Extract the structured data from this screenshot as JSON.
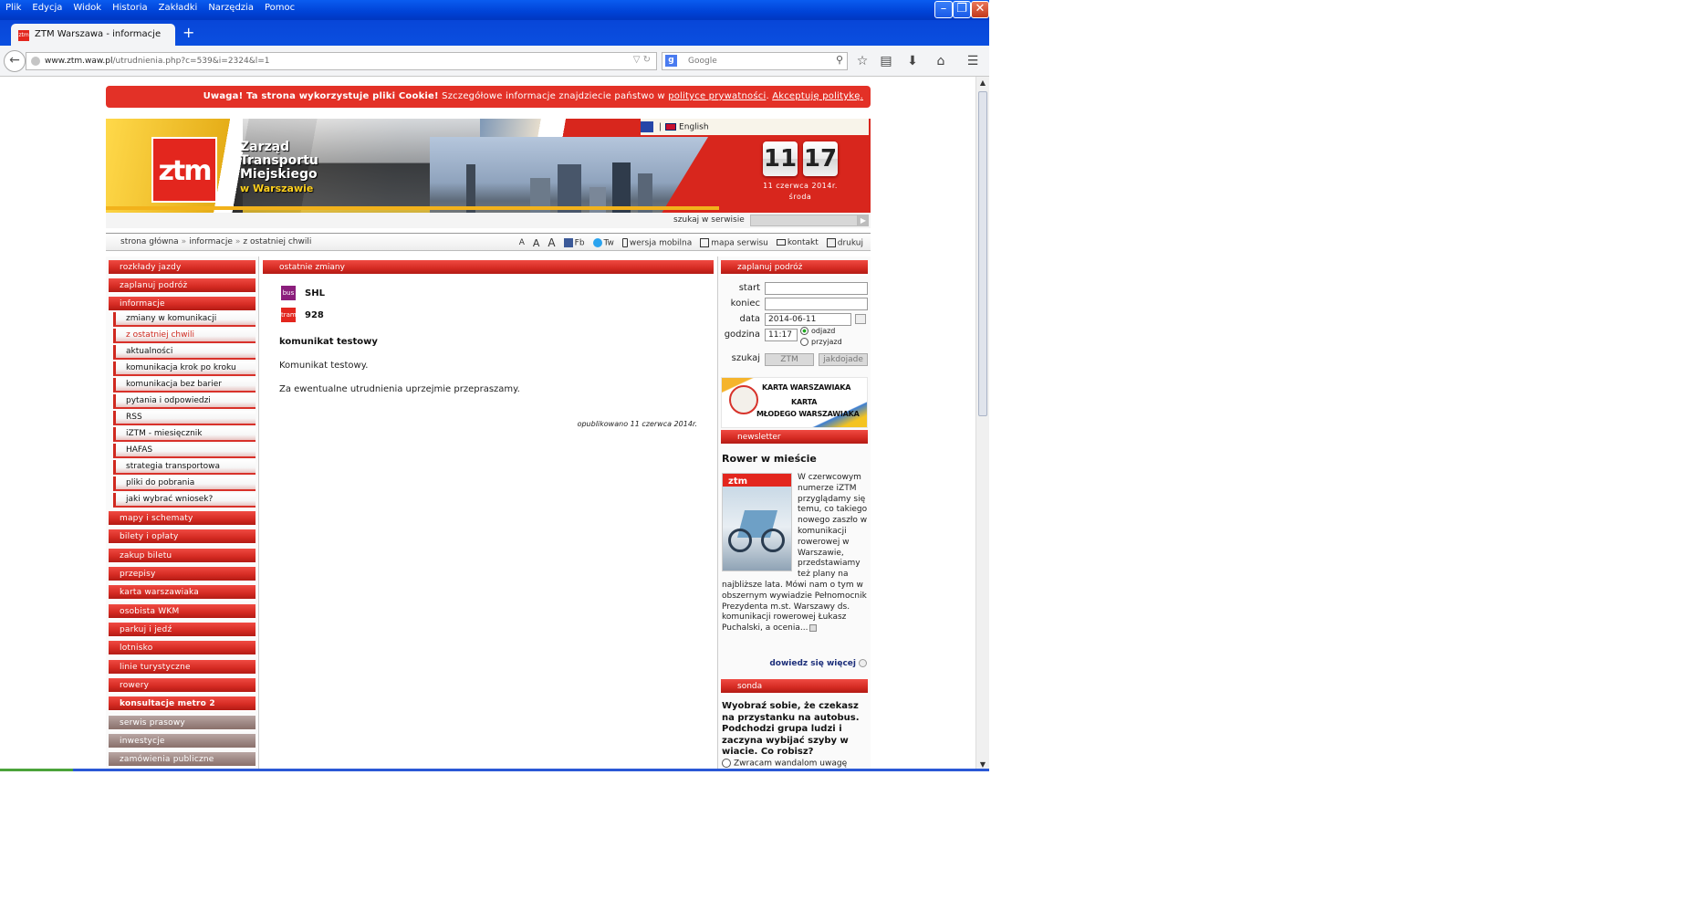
{
  "browser": {
    "menu": [
      "Plik",
      "Edycja",
      "Widok",
      "Historia",
      "Zakładki",
      "Narzędzia",
      "Pomoc"
    ],
    "tab_title": "ZTM Warszawa - informacje",
    "favicon_text": "ztm",
    "url_domain": "www.ztm.waw.pl",
    "url_path": "/utrudnienia.php?c=539&i=2324&l=1",
    "search_placeholder": "Google",
    "icons": [
      "back-icon",
      "reload-icon",
      "search-icon",
      "bookmark-star-icon",
      "bookmarks-list-icon",
      "download-icon",
      "home-icon",
      "menu-icon"
    ]
  },
  "cookie": {
    "bold": "Uwaga! Ta strona wykorzystuje pliki Cookie!",
    "text": " Szczegółowe informacje znajdziecie państwo w ",
    "link1": "polityce prywatności",
    "text2": ". ",
    "link2": "Akceptuję politykę."
  },
  "header": {
    "logo": "ztm",
    "brand_line1": "Zarząd",
    "brand_line2": "Transportu",
    "brand_line3": "Miejskiego",
    "brand_line4": "w Warszawie",
    "lang_sep": "|",
    "lang": "English",
    "clock_hour": "11",
    "clock_min": "17",
    "date": "11 czerwca 2014r.",
    "weekday": "środa",
    "search_label": "szukaj w serwisie"
  },
  "breadcrumb": [
    "strona główna",
    "informacje",
    "z ostatniej chwili"
  ],
  "breadcrumb_sep": "»",
  "tools": {
    "font_a1": "A",
    "font_a2": "A",
    "font_a3": "A",
    "fb": "Fb",
    "tw": "Tw",
    "mobile": "wersja mobilna",
    "map": "mapa serwisu",
    "contact": "kontakt",
    "print": "drukuj"
  },
  "left_nav": {
    "top": [
      "rozkłady jazdy",
      "zaplanuj podróż",
      "informacje"
    ],
    "sub": [
      "zmiany w komunikacji",
      "z ostatniej chwili",
      "aktualności",
      "komunikacja krok po kroku",
      "komunikacja bez barier",
      "pytania i odpowiedzi",
      "RSS",
      "iZTM - miesięcznik",
      "HAFAS",
      "strategia transportowa",
      "pliki do pobrania",
      "jaki wybrać wniosek?"
    ],
    "bottom": [
      "mapy i schematy",
      "bilety i opłaty",
      "zakup biletu",
      "przepisy",
      "karta warszawiaka",
      "osobista WKM",
      "parkuj i jedź",
      "lotnisko",
      "linie turystyczne",
      "rowery",
      "konsultacje metro 2",
      "serwis prasowy",
      "inwestycje",
      "zamówienia publiczne"
    ]
  },
  "main": {
    "title": "ostatnie zmiany",
    "lines": [
      {
        "mode": "bus",
        "line": "SHL"
      },
      {
        "mode": "tram",
        "line": "928"
      }
    ],
    "message_title": "komunikat testowy",
    "message_p1": "Komunikat testowy.",
    "message_p2": "Za ewentualne utrudnienia uprzejmie przepraszamy.",
    "published": "opublikowano 11 czerwca 2014r."
  },
  "planner": {
    "title": "zaplanuj podróż",
    "start_label": "start",
    "end_label": "koniec",
    "date_label": "data",
    "date_value": "2014-06-11",
    "time_label": "godzina",
    "time_value": "11:17",
    "depart": "odjazd",
    "arrive": "przyjazd",
    "search_label": "szukaj",
    "btn_ztm": "ZTM",
    "btn_jakdojade": "jakdojade"
  },
  "card_banner": {
    "line1": "KARTA WARSZAWIAKA",
    "line2": "KARTA",
    "line3": "MŁODEGO WARSZAWIAKA"
  },
  "newsletter": {
    "title": "newsletter",
    "heading": "Rower w mieście",
    "thumb_label": "ztm",
    "text": "W czerwcowym numerze iZTM przyglądamy się temu, co takiego nowego zaszło w komunikacji rowerowej w Warszawie, przedstawiamy też plany na najbliższe lata. Mówi nam o tym w obszernym wywiadzie Pełnomocnik Prezydenta m.st. Warszawy ds. komunikacji rowerowej Łukasz Puchalski, a ocenia...",
    "more": "dowiedz się więcej"
  },
  "poll": {
    "title": "sonda",
    "question": "Wyobraź sobie, że czekasz na przystanku na autobus. Podchodzi grupa ludzi i zaczyna wybijać szyby w wiacie. Co robisz?",
    "option1": "Zwracam wandalom uwagę"
  }
}
